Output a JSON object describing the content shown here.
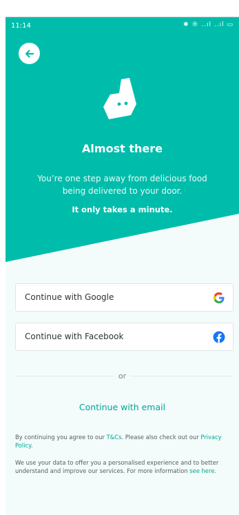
{
  "status_bar": {
    "time": "11:14",
    "icons_text": "✱ ® ..ıl ..ıl ▭"
  },
  "hero": {
    "title": "Almost there",
    "subtitle": "You’re one step away from delicious food being delivered to your door.",
    "tagline": "It only takes a minute."
  },
  "auth": {
    "google_label": "Continue with Google",
    "facebook_label": "Continue with Facebook",
    "divider_text": "or",
    "email_label": "Continue with email"
  },
  "legal": {
    "terms_prefix": "By continuing you agree to our ",
    "terms_link": "T&Cs",
    "terms_middle": ". Please also check out our ",
    "privacy_link": "Privacy Policy",
    "terms_suffix": ".",
    "data_text": "We use your data to offer you a personalised experience and to better understand and improve our services. For more information ",
    "data_link": "see here",
    "data_suffix": "."
  },
  "colors": {
    "brand_teal": "#00bdab",
    "link_teal": "#00a693",
    "google_red": "#ea4335",
    "google_blue": "#4285f4",
    "google_yellow": "#fbbc05",
    "google_green": "#34a853",
    "facebook_blue": "#1877f2"
  },
  "icons": {
    "back": "arrow-left",
    "logo": "deliveroo-kangaroo",
    "google": "google-g",
    "facebook": "facebook-f"
  }
}
